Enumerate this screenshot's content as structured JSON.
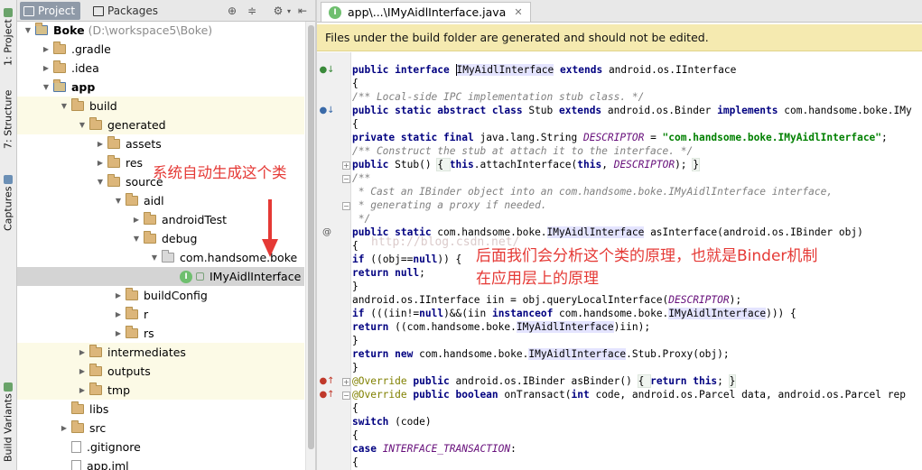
{
  "left_strip": {
    "tabs": [
      "1: Project",
      "7: Structure",
      "Captures",
      "Build Variants"
    ]
  },
  "project_panel": {
    "tabs": [
      {
        "label": "Project",
        "active": true
      },
      {
        "label": "Packages",
        "active": false
      }
    ],
    "tree": [
      {
        "label": "Boke",
        "hint": "(D:\\workspace5\\Boke)",
        "depth": 0,
        "expanded": true,
        "icon": "module-folder-icon",
        "bold": true
      },
      {
        "label": ".gradle",
        "depth": 1,
        "expanded": false,
        "icon": "folder-icon"
      },
      {
        "label": ".idea",
        "depth": 1,
        "expanded": false,
        "icon": "folder-icon"
      },
      {
        "label": "app",
        "depth": 1,
        "expanded": true,
        "icon": "module-folder-icon",
        "bold": true
      },
      {
        "label": "build",
        "depth": 2,
        "expanded": true,
        "icon": "folder-icon",
        "highlight": true
      },
      {
        "label": "generated",
        "depth": 3,
        "expanded": true,
        "icon": "folder-icon",
        "highlight": true
      },
      {
        "label": "assets",
        "depth": 4,
        "expanded": false,
        "icon": "folder-icon"
      },
      {
        "label": "res",
        "depth": 4,
        "expanded": false,
        "icon": "folder-icon"
      },
      {
        "label": "source",
        "depth": 4,
        "expanded": true,
        "icon": "folder-icon"
      },
      {
        "label": "aidl",
        "depth": 5,
        "expanded": true,
        "icon": "folder-icon"
      },
      {
        "label": "androidTest",
        "depth": 6,
        "expanded": false,
        "icon": "folder-icon"
      },
      {
        "label": "debug",
        "depth": 6,
        "expanded": true,
        "icon": "source-folder-icon"
      },
      {
        "label": "com.handsome.boke",
        "depth": 7,
        "expanded": true,
        "icon": "package-icon"
      },
      {
        "label": "IMyAidlInterface",
        "depth": 8,
        "leaf": true,
        "icon": "interface-icon",
        "selected": true
      },
      {
        "label": "buildConfig",
        "depth": 5,
        "expanded": false,
        "icon": "folder-icon"
      },
      {
        "label": "r",
        "depth": 5,
        "expanded": false,
        "icon": "folder-icon"
      },
      {
        "label": "rs",
        "depth": 5,
        "expanded": false,
        "icon": "folder-icon"
      },
      {
        "label": "intermediates",
        "depth": 3,
        "expanded": false,
        "icon": "folder-icon",
        "highlight": true
      },
      {
        "label": "outputs",
        "depth": 3,
        "expanded": false,
        "icon": "folder-icon",
        "highlight": true
      },
      {
        "label": "tmp",
        "depth": 3,
        "expanded": false,
        "icon": "folder-icon",
        "highlight": true
      },
      {
        "label": "libs",
        "depth": 2,
        "leaf": true,
        "icon": "folder-icon"
      },
      {
        "label": "src",
        "depth": 2,
        "expanded": false,
        "icon": "folder-icon"
      },
      {
        "label": ".gitignore",
        "depth": 2,
        "leaf": true,
        "icon": "file-icon"
      },
      {
        "label": "app.iml",
        "depth": 2,
        "leaf": true,
        "icon": "file-icon"
      }
    ]
  },
  "editor": {
    "tab_label": "app\\...\\IMyAidlInterface.java",
    "banner": "Files under the build folder are generated and should not be edited.",
    "code_lines": [
      [
        [
          "kw",
          "public "
        ],
        [
          "kw",
          "interface "
        ],
        [
          "hl",
          "IMyAidlInterface"
        ],
        [
          "t",
          " "
        ],
        [
          "kw",
          "extends "
        ],
        [
          "t",
          "android.os.IInterface"
        ]
      ],
      [
        [
          "t",
          "{"
        ]
      ],
      [
        [
          "cm",
          "/** Local-side IPC implementation stub class. */"
        ]
      ],
      [
        [
          "kw",
          "public static abstract class "
        ],
        [
          "t",
          "Stub "
        ],
        [
          "kw",
          "extends "
        ],
        [
          "t",
          "android.os.Binder "
        ],
        [
          "kw",
          "implements "
        ],
        [
          "t",
          "com.handsome.boke.IMy"
        ]
      ],
      [
        [
          "t",
          "{"
        ]
      ],
      [
        [
          "kw",
          "private static final "
        ],
        [
          "t",
          "java.lang.String "
        ],
        [
          "fi",
          "DESCRIPTOR"
        ],
        [
          "t",
          " = "
        ],
        [
          "st",
          "\"com.handsome.boke.IMyAidlInterface\""
        ],
        [
          "t",
          ";"
        ]
      ],
      [
        [
          "cm",
          "/** Construct the stub at attach it to the interface. */"
        ]
      ],
      [
        [
          "kw",
          "public "
        ],
        [
          "t",
          "Stub() "
        ],
        [
          "fb",
          "{ "
        ],
        [
          "kw",
          "this"
        ],
        [
          "t",
          ".attachInterface("
        ],
        [
          "kw",
          "this"
        ],
        [
          "t",
          ", "
        ],
        [
          "fi",
          "DESCRIPTOR"
        ],
        [
          "t",
          "); "
        ],
        [
          "fb",
          "}"
        ]
      ],
      [
        [
          "cm",
          "/**"
        ]
      ],
      [
        [
          "cm",
          " * Cast an IBinder object into an com.handsome.boke.IMyAidlInterface interface,"
        ]
      ],
      [
        [
          "cm",
          " * generating a proxy if needed."
        ]
      ],
      [
        [
          "cm",
          " */"
        ]
      ],
      [
        [
          "kw",
          "public static "
        ],
        [
          "t",
          "com.handsome.boke."
        ],
        [
          "hl",
          "IMyAidlInterface"
        ],
        [
          "t",
          " asInterface(android.os.IBinder obj)"
        ]
      ],
      [
        [
          "t",
          "{"
        ]
      ],
      [
        [
          "kw",
          "if "
        ],
        [
          "t",
          "((obj=="
        ],
        [
          "kw",
          "null"
        ],
        [
          "t",
          ")) {"
        ]
      ],
      [
        [
          "kw",
          "return null"
        ],
        [
          "t",
          ";"
        ]
      ],
      [
        [
          "t",
          "}"
        ]
      ],
      [
        [
          "t",
          "android.os.IInterface iin = obj.queryLocalInterface("
        ],
        [
          "fi",
          "DESCRIPTOR"
        ],
        [
          "t",
          ");"
        ]
      ],
      [
        [
          "kw",
          "if "
        ],
        [
          "t",
          "(((iin!="
        ],
        [
          "kw",
          "null"
        ],
        [
          "t",
          ")&&(iin "
        ],
        [
          "kw",
          "instanceof "
        ],
        [
          "t",
          "com.handsome.boke."
        ],
        [
          "hl",
          "IMyAidlInterface"
        ],
        [
          "t",
          "))) {"
        ]
      ],
      [
        [
          "kw",
          "return "
        ],
        [
          "t",
          "((com.handsome.boke."
        ],
        [
          "hl",
          "IMyAidlInterface"
        ],
        [
          "t",
          ")iin);"
        ]
      ],
      [
        [
          "t",
          "}"
        ]
      ],
      [
        [
          "kw",
          "return new "
        ],
        [
          "t",
          "com.handsome.boke."
        ],
        [
          "hl",
          "IMyAidlInterface"
        ],
        [
          "t",
          ".Stub.Proxy(obj);"
        ]
      ],
      [
        [
          "t",
          "}"
        ]
      ],
      [
        [
          "an",
          "@Override "
        ],
        [
          "kw",
          "public "
        ],
        [
          "t",
          "android.os.IBinder asBinder() "
        ],
        [
          "fb",
          "{ "
        ],
        [
          "kw",
          "return this"
        ],
        [
          "t",
          "; "
        ],
        [
          "fb",
          "}"
        ]
      ],
      [
        [
          "an",
          "@Override "
        ],
        [
          "kw",
          "public boolean "
        ],
        [
          "t",
          "onTransact("
        ],
        [
          "kw",
          "int "
        ],
        [
          "t",
          "code, android.os.Parcel data, android.os.Parcel rep"
        ]
      ],
      [
        [
          "t",
          "{"
        ]
      ],
      [
        [
          "kw",
          "switch "
        ],
        [
          "t",
          "(code)"
        ]
      ],
      [
        [
          "t",
          "{"
        ]
      ],
      [
        [
          "kw",
          "case "
        ],
        [
          "fi",
          "INTERFACE_TRANSACTION"
        ],
        [
          "t",
          ":"
        ]
      ],
      [
        [
          "t",
          "{"
        ]
      ]
    ]
  },
  "annotations": {
    "left_note": "系统自动生成这个类",
    "right_note_line1": "后面我们会分析这个类的原理，也就是Binder机制",
    "right_note_line2": "在应用层上的原理",
    "watermark": "http://blog.csdn.net/"
  },
  "colors": {
    "annotation": "#e53935",
    "banner": "#f5eab0",
    "selection": "#d4d4d4",
    "highlight_row": "#fcfae6"
  }
}
